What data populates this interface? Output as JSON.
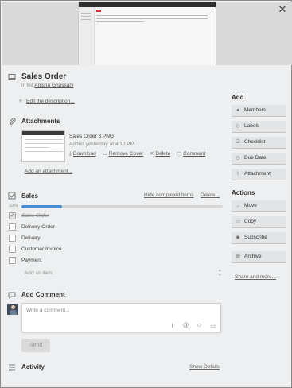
{
  "close": {
    "glyph": "✕"
  },
  "card": {
    "title": "Sales Order",
    "in_list_prefix": "in list",
    "list_name": "Anisha Ghassani",
    "edit_description": "Edit the description..."
  },
  "attachments": {
    "heading": "Attachments",
    "file_name": "Sales Order 3.PNG",
    "added": "Added yesterday at 4:10 PM",
    "actions": {
      "download": "Download",
      "remove_cover": "Remove Cover",
      "delete": "Delete",
      "comment": "Comment"
    },
    "add_link": "Add an attachment..."
  },
  "checklist": {
    "title": "Sales",
    "hide_completed": "Hide completed items",
    "delete": "Delete...",
    "percent_label": "20%",
    "progress": 0.2,
    "items": [
      {
        "label": "Sales Order",
        "done": true
      },
      {
        "label": "Delivery Order",
        "done": false
      },
      {
        "label": "Delivery",
        "done": false
      },
      {
        "label": "Customer Invoice",
        "done": false
      },
      {
        "label": "Payment",
        "done": false
      }
    ],
    "add_item_placeholder": "Add an item..."
  },
  "comment": {
    "heading": "Add Comment",
    "placeholder": "Write a comment...",
    "send_label": "Send"
  },
  "activity": {
    "heading": "Activity",
    "show_details": "Show Details"
  },
  "sidebar": {
    "add_heading": "Add",
    "add_buttons": [
      {
        "label": "Members",
        "icon": "person-icon"
      },
      {
        "label": "Labels",
        "icon": "tag-icon"
      },
      {
        "label": "Checklist",
        "icon": "checkbox-icon"
      },
      {
        "label": "Due Date",
        "icon": "calendar-icon"
      },
      {
        "label": "Attachment",
        "icon": "paperclip-icon"
      }
    ],
    "actions_heading": "Actions",
    "action_buttons": [
      {
        "label": "Move",
        "icon": "arrow-right-icon"
      },
      {
        "label": "Copy",
        "icon": "copy-icon"
      },
      {
        "label": "Subscribe",
        "icon": "eye-icon"
      },
      {
        "label": "Archive",
        "icon": "archive-icon"
      }
    ],
    "share_more": "Share and more..."
  },
  "colors": {
    "progress_fill": "#4a8bd6",
    "panel_bg": "#edeff0",
    "button_bg": "#e2e4e6"
  }
}
